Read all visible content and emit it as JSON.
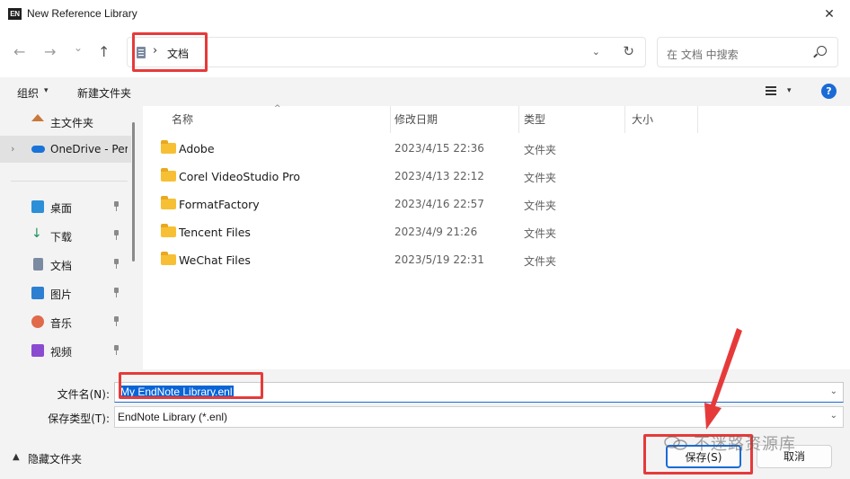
{
  "window": {
    "app_icon_text": "EN",
    "title": "New Reference Library",
    "close_glyph": "✕"
  },
  "nav": {
    "back": "←",
    "forward": "→",
    "recent": "⌄",
    "up": "↑",
    "address": {
      "chevron": "›",
      "path": "文档",
      "dropdown": "⌄",
      "refresh": "↻"
    },
    "search": {
      "placeholder": "在 文档 中搜索"
    }
  },
  "commands": {
    "organize": "组织",
    "organize_dd": "▾",
    "new_folder": "新建文件夹",
    "view_dd": "▾",
    "help": "?"
  },
  "sidebar": {
    "items": [
      {
        "label": "主文件夹",
        "icon": "home-icon"
      },
      {
        "label": "OneDrive - Per",
        "icon": "onedrive-icon",
        "chevron": "›"
      },
      {
        "label": "桌面",
        "icon": "desktop-icon"
      },
      {
        "label": "下载",
        "icon": "download-icon"
      },
      {
        "label": "文档",
        "icon": "document-icon"
      },
      {
        "label": "图片",
        "icon": "pictures-icon"
      },
      {
        "label": "音乐",
        "icon": "music-icon"
      },
      {
        "label": "视频",
        "icon": "video-icon"
      }
    ]
  },
  "columns": {
    "name": "名称",
    "modified": "修改日期",
    "type": "类型",
    "size": "大小",
    "sort_caret": "^"
  },
  "files": [
    {
      "name": "Adobe",
      "modified": "2023/4/15 22:36",
      "type": "文件夹"
    },
    {
      "name": "Corel VideoStudio Pro",
      "modified": "2023/4/13 22:12",
      "type": "文件夹"
    },
    {
      "name": "FormatFactory",
      "modified": "2023/4/16 22:57",
      "type": "文件夹"
    },
    {
      "name": "Tencent Files",
      "modified": "2023/4/9 21:26",
      "type": "文件夹"
    },
    {
      "name": "WeChat Files",
      "modified": "2023/5/19 22:31",
      "type": "文件夹"
    }
  ],
  "form": {
    "filename_label": "文件名(N):",
    "filename_value": "My EndNote Library.enl",
    "filetype_label": "保存类型(T):",
    "filetype_value": "EndNote Library (*.enl)",
    "dd": "⌄"
  },
  "footer": {
    "hide_chevron": "▲",
    "hide_folders": "隐藏文件夹",
    "save": "保存(S)",
    "cancel": "取消"
  },
  "watermark": "不迷路资源库",
  "colors": {
    "accent": "#1a6bd6",
    "annotation": "#e63a3a",
    "folder": "#f7c034"
  }
}
